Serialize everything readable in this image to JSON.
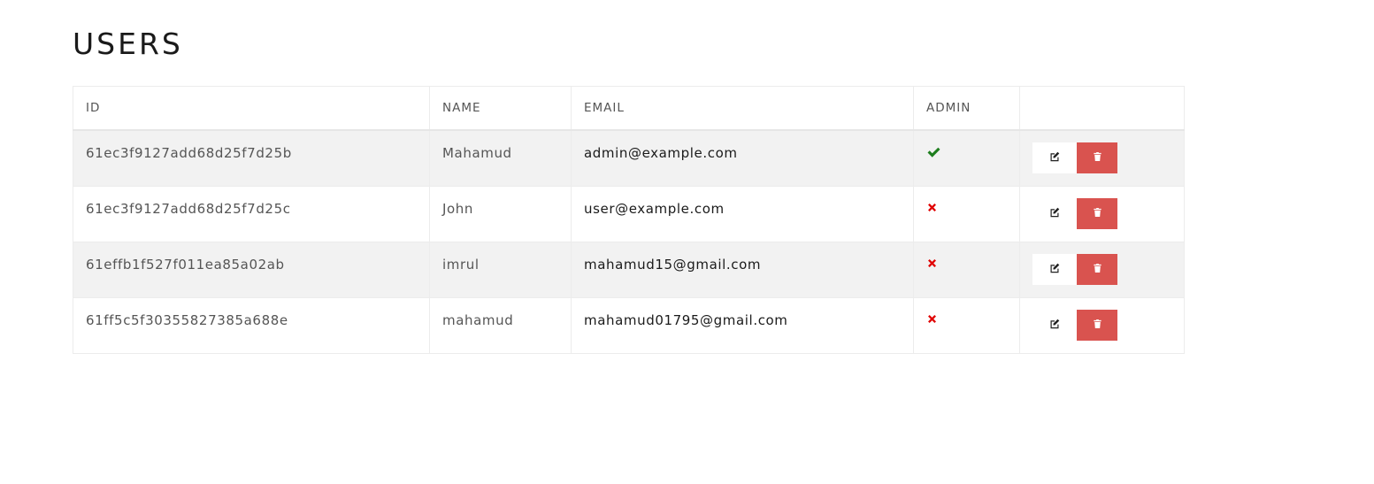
{
  "page": {
    "title": "USERS"
  },
  "table": {
    "columns": [
      "ID",
      "NAME",
      "EMAIL",
      "ADMIN",
      ""
    ],
    "rows": [
      {
        "id": "61ec3f9127add68d25f7d25b",
        "name": "Mahamud",
        "email": "admin@example.com",
        "admin": true
      },
      {
        "id": "61ec3f9127add68d25f7d25c",
        "name": "John",
        "email": "user@example.com",
        "admin": false
      },
      {
        "id": "61effb1f527f011ea85a02ab",
        "name": "imrul",
        "email": "mahamud15@gmail.com",
        "admin": false
      },
      {
        "id": "61ff5c5f30355827385a688e",
        "name": "mahamud",
        "email": "mahamud01795@gmail.com",
        "admin": false
      }
    ],
    "row_actions": {
      "edit_icon": "edit-icon",
      "delete_icon": "trash-icon"
    }
  },
  "colors": {
    "admin_yes": "#1e7e1e",
    "admin_no": "#e00000",
    "delete_button": "#d9534f"
  }
}
